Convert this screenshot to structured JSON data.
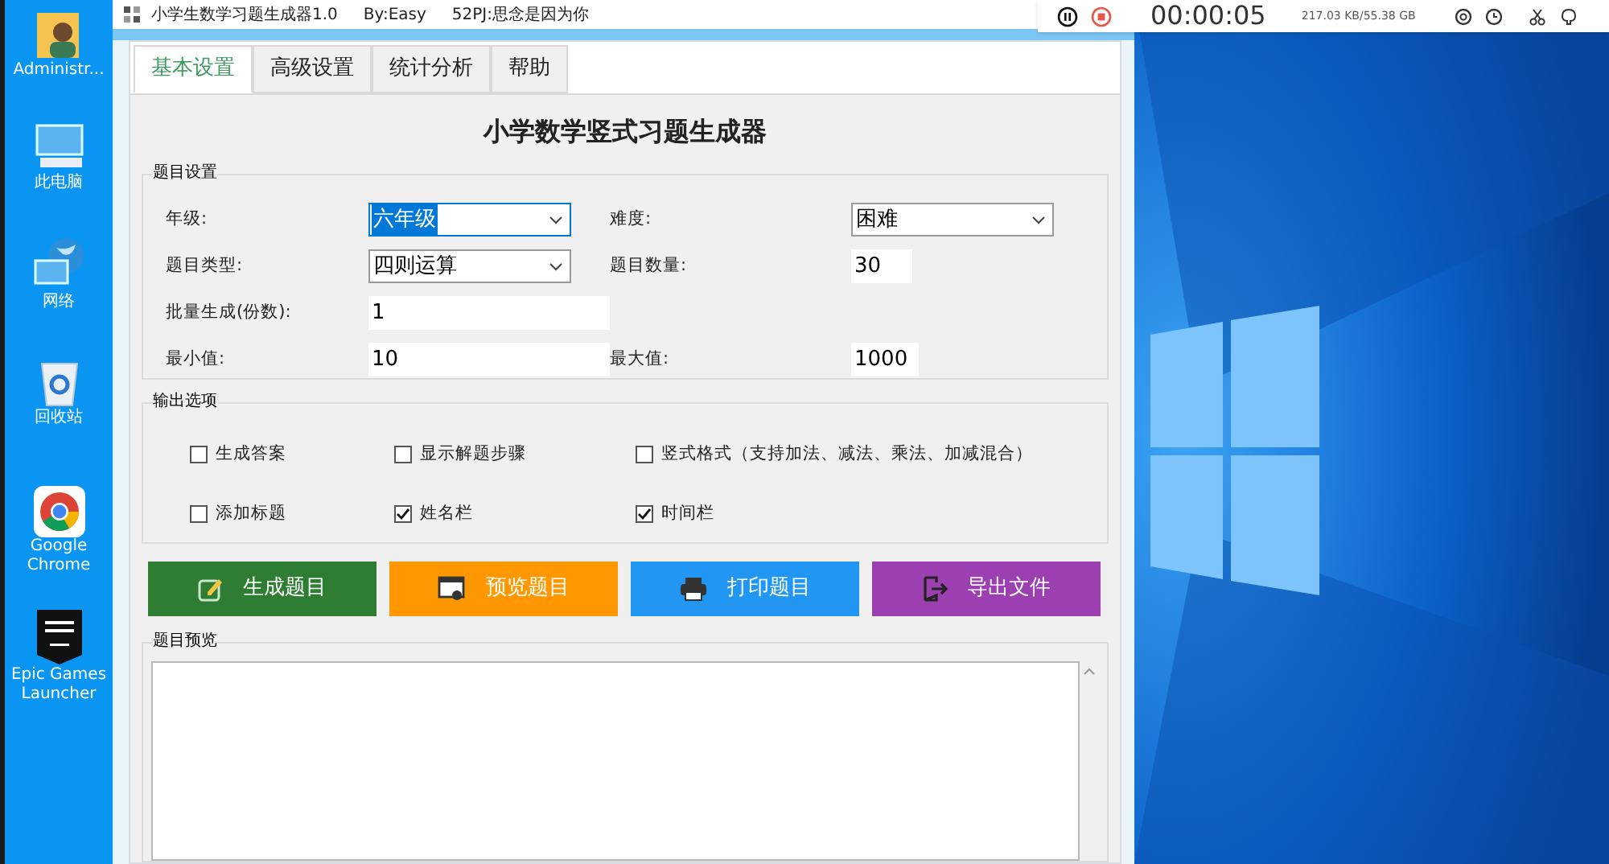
{
  "desktop_icons": [
    {
      "kind": "user",
      "label": "Administr..."
    },
    {
      "kind": "computer",
      "label": "此电脑"
    },
    {
      "kind": "network",
      "label": "网络"
    },
    {
      "kind": "recycle",
      "label": "回收站"
    },
    {
      "kind": "chrome",
      "label": "Google Chrome"
    },
    {
      "kind": "epic",
      "label": "Epic Games Launcher"
    }
  ],
  "recorder": {
    "time": "00:00:05",
    "size": "217.03 KB/55.38 GB"
  },
  "window": {
    "title": "小学生数学习题生成器1.0",
    "author": "By:Easy",
    "credit": "52PJ:思念是因为你"
  },
  "tabs": [
    {
      "label": "基本设置",
      "selected": true
    },
    {
      "label": "高级设置",
      "selected": false
    },
    {
      "label": "统计分析",
      "selected": false
    },
    {
      "label": "帮助",
      "selected": false
    }
  ],
  "heading": "小学数学竖式习题生成器",
  "question_settings": {
    "title": "题目设置",
    "fields": [
      {
        "label": "年级:",
        "kind": "select",
        "value": "六年级",
        "focused": true
      },
      {
        "label": "难度:",
        "kind": "select",
        "value": "困难",
        "focused": false
      },
      {
        "label": "题目类型:",
        "kind": "select",
        "value": "四则运算",
        "focused": false
      },
      {
        "label": "题目数量:",
        "kind": "input",
        "value": "30",
        "focused": false
      },
      {
        "label": "批量生成(份数):",
        "kind": "input",
        "value": "1",
        "focused": false
      },
      {
        "label": "最小值:",
        "kind": "input",
        "value": "10",
        "focused": false
      },
      {
        "label": "最大值:",
        "kind": "input",
        "value": "1000",
        "focused": false
      }
    ]
  },
  "output_options": {
    "title": "输出选项",
    "options": [
      {
        "label": "生成答案",
        "checked": false
      },
      {
        "label": "显示解题步骤",
        "checked": false
      },
      {
        "label": "竖式格式（支持加法、减法、乘法、加减混合）",
        "checked": false
      },
      {
        "label": "添加标题",
        "checked": false
      },
      {
        "label": "姓名栏",
        "checked": true
      },
      {
        "label": "时间栏",
        "checked": true
      }
    ]
  },
  "buttons": [
    {
      "kind": "generate",
      "label": "生成题目",
      "color": "#2e7d32"
    },
    {
      "kind": "preview",
      "label": "预览题目",
      "color": "#ff9800"
    },
    {
      "kind": "print",
      "label": "打印题目",
      "color": "#2196f3"
    },
    {
      "kind": "export",
      "label": "导出文件",
      "color": "#9c3fb0"
    }
  ],
  "preview": {
    "title": "题目预览"
  }
}
